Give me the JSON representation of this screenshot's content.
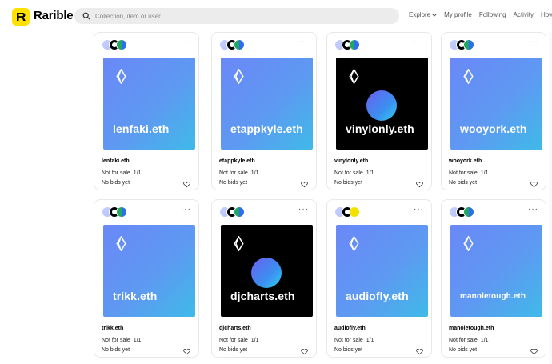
{
  "header": {
    "brand": "Rarible",
    "search_placeholder": "Collection, item or user",
    "nav": [
      "Explore",
      "My profile",
      "Following",
      "Activity",
      "How"
    ]
  },
  "cards": [
    {
      "name": "lenfaki.eth",
      "art_label": "lenfaki.eth",
      "style": "blue",
      "status": "Not for sale",
      "quantity": "1/1",
      "bids": "No bids yet"
    },
    {
      "name": "etappkyle.eth",
      "art_label": "etappkyle.eth",
      "style": "blue",
      "status": "Not for sale",
      "quantity": "1/1",
      "bids": "No bids yet"
    },
    {
      "name": "vinylonly.eth",
      "art_label": "vinylonly.eth",
      "style": "black",
      "status": "Not for sale",
      "quantity": "1/1",
      "bids": "No bids yet"
    },
    {
      "name": "wooyork.eth",
      "art_label": "wooyork.eth",
      "style": "blue",
      "status": "Not for sale",
      "quantity": "1/1",
      "bids": "No bids yet"
    },
    {
      "name": "trikk.eth",
      "art_label": "trikk.eth",
      "style": "blue",
      "status": "Not for sale",
      "quantity": "1/1",
      "bids": "No bids yet"
    },
    {
      "name": "djcharts.eth",
      "art_label": "djcharts.eth",
      "style": "black",
      "status": "Not for sale",
      "quantity": "1/1",
      "bids": "No bids yet"
    },
    {
      "name": "audiofly.eth",
      "art_label": "audiofly.eth",
      "style": "blue",
      "status": "Not for sale",
      "quantity": "1/1",
      "bids": "No bids yet"
    },
    {
      "name": "manoletough.eth",
      "art_label": "manoletough.eth",
      "style": "blue",
      "status": "Not for sale",
      "quantity": "1/1",
      "bids": "No bids yet"
    }
  ],
  "colors": {
    "brand_yellow": "#fee100",
    "art_blue": "#5e99f2",
    "art_black": "#000000"
  },
  "icons": {
    "search": "search-icon",
    "menu": "more-dots-icon",
    "like": "heart-icon",
    "ens": "ens-logo-icon"
  }
}
